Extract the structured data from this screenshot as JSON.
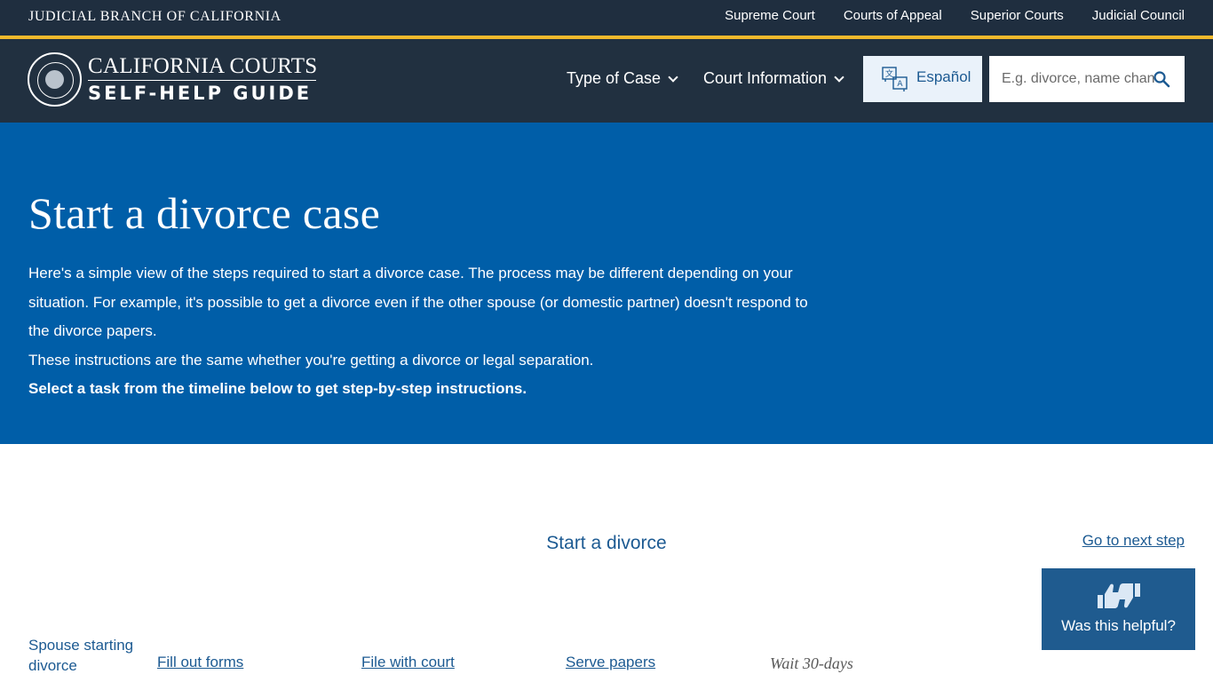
{
  "topbar": {
    "brand": "JUDICIAL BRANCH OF CALIFORNIA",
    "links": [
      "Supreme Court",
      "Courts of Appeal",
      "Superior Courts",
      "Judicial Council"
    ]
  },
  "header": {
    "logo_line1": "CALIFORNIA COURTS",
    "logo_line2": "SELF-HELP GUIDE",
    "nav": [
      {
        "label": "Type of Case"
      },
      {
        "label": "Court Information"
      }
    ],
    "language_button": "Español",
    "search_placeholder": "E.g. divorce, name change,"
  },
  "hero": {
    "title": "Start a divorce case",
    "intro": "Here's a simple view of the steps required to start a divorce case. The process may be different depending on your situation. For example, it's possible to get a divorce even if the other spouse (or domestic partner) doesn't respond to the divorce papers.",
    "note": "These instructions are the same whether you're getting a divorce or legal separation.",
    "instruction": "Select a task from the timeline below to get step-by-step instructions."
  },
  "timeline": {
    "title": "Start a divorce",
    "next_step": "Go to next step",
    "row_label": "Spouse starting divorce",
    "steps": [
      "Fill out forms",
      "File with court",
      "Serve papers"
    ],
    "wait": "Wait 30-days"
  },
  "feedback": {
    "label": "Was this helpful?"
  },
  "colors": {
    "topbar_bg": "#1f2e3f",
    "accent_gold": "#f2b92c",
    "hero_bg": "#005ea8",
    "link_blue": "#1c5a92",
    "feedback_bg": "#1f5b8f"
  },
  "icons": [
    "court-seal-icon",
    "chevron-down-icon",
    "translate-icon",
    "search-icon",
    "thumbs-up-down-icon"
  ]
}
